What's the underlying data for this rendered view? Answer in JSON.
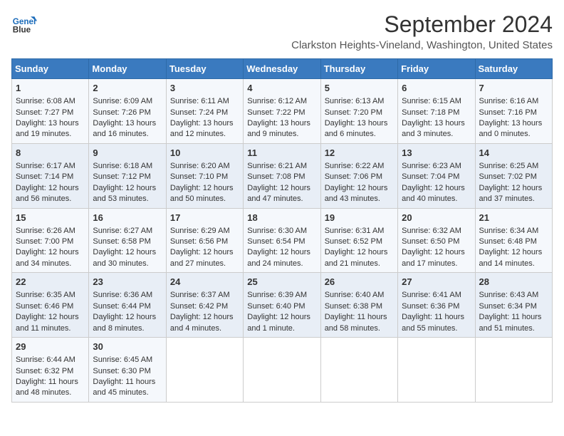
{
  "header": {
    "logo_line1": "General",
    "logo_line2": "Blue",
    "title": "September 2024",
    "subtitle": "Clarkston Heights-Vineland, Washington, United States"
  },
  "days": [
    "Sunday",
    "Monday",
    "Tuesday",
    "Wednesday",
    "Thursday",
    "Friday",
    "Saturday"
  ],
  "weeks": [
    [
      {
        "day": 1,
        "sunrise": "6:08 AM",
        "sunset": "7:27 PM",
        "daylight": "13 hours and 19 minutes."
      },
      {
        "day": 2,
        "sunrise": "6:09 AM",
        "sunset": "7:26 PM",
        "daylight": "13 hours and 16 minutes."
      },
      {
        "day": 3,
        "sunrise": "6:11 AM",
        "sunset": "7:24 PM",
        "daylight": "13 hours and 12 minutes."
      },
      {
        "day": 4,
        "sunrise": "6:12 AM",
        "sunset": "7:22 PM",
        "daylight": "13 hours and 9 minutes."
      },
      {
        "day": 5,
        "sunrise": "6:13 AM",
        "sunset": "7:20 PM",
        "daylight": "13 hours and 6 minutes."
      },
      {
        "day": 6,
        "sunrise": "6:15 AM",
        "sunset": "7:18 PM",
        "daylight": "13 hours and 3 minutes."
      },
      {
        "day": 7,
        "sunrise": "6:16 AM",
        "sunset": "7:16 PM",
        "daylight": "13 hours and 0 minutes."
      }
    ],
    [
      {
        "day": 8,
        "sunrise": "6:17 AM",
        "sunset": "7:14 PM",
        "daylight": "12 hours and 56 minutes."
      },
      {
        "day": 9,
        "sunrise": "6:18 AM",
        "sunset": "7:12 PM",
        "daylight": "12 hours and 53 minutes."
      },
      {
        "day": 10,
        "sunrise": "6:20 AM",
        "sunset": "7:10 PM",
        "daylight": "12 hours and 50 minutes."
      },
      {
        "day": 11,
        "sunrise": "6:21 AM",
        "sunset": "7:08 PM",
        "daylight": "12 hours and 47 minutes."
      },
      {
        "day": 12,
        "sunrise": "6:22 AM",
        "sunset": "7:06 PM",
        "daylight": "12 hours and 43 minutes."
      },
      {
        "day": 13,
        "sunrise": "6:23 AM",
        "sunset": "7:04 PM",
        "daylight": "12 hours and 40 minutes."
      },
      {
        "day": 14,
        "sunrise": "6:25 AM",
        "sunset": "7:02 PM",
        "daylight": "12 hours and 37 minutes."
      }
    ],
    [
      {
        "day": 15,
        "sunrise": "6:26 AM",
        "sunset": "7:00 PM",
        "daylight": "12 hours and 34 minutes."
      },
      {
        "day": 16,
        "sunrise": "6:27 AM",
        "sunset": "6:58 PM",
        "daylight": "12 hours and 30 minutes."
      },
      {
        "day": 17,
        "sunrise": "6:29 AM",
        "sunset": "6:56 PM",
        "daylight": "12 hours and 27 minutes."
      },
      {
        "day": 18,
        "sunrise": "6:30 AM",
        "sunset": "6:54 PM",
        "daylight": "12 hours and 24 minutes."
      },
      {
        "day": 19,
        "sunrise": "6:31 AM",
        "sunset": "6:52 PM",
        "daylight": "12 hours and 21 minutes."
      },
      {
        "day": 20,
        "sunrise": "6:32 AM",
        "sunset": "6:50 PM",
        "daylight": "12 hours and 17 minutes."
      },
      {
        "day": 21,
        "sunrise": "6:34 AM",
        "sunset": "6:48 PM",
        "daylight": "12 hours and 14 minutes."
      }
    ],
    [
      {
        "day": 22,
        "sunrise": "6:35 AM",
        "sunset": "6:46 PM",
        "daylight": "12 hours and 11 minutes."
      },
      {
        "day": 23,
        "sunrise": "6:36 AM",
        "sunset": "6:44 PM",
        "daylight": "12 hours and 8 minutes."
      },
      {
        "day": 24,
        "sunrise": "6:37 AM",
        "sunset": "6:42 PM",
        "daylight": "12 hours and 4 minutes."
      },
      {
        "day": 25,
        "sunrise": "6:39 AM",
        "sunset": "6:40 PM",
        "daylight": "12 hours and 1 minute."
      },
      {
        "day": 26,
        "sunrise": "6:40 AM",
        "sunset": "6:38 PM",
        "daylight": "11 hours and 58 minutes."
      },
      {
        "day": 27,
        "sunrise": "6:41 AM",
        "sunset": "6:36 PM",
        "daylight": "11 hours and 55 minutes."
      },
      {
        "day": 28,
        "sunrise": "6:43 AM",
        "sunset": "6:34 PM",
        "daylight": "11 hours and 51 minutes."
      }
    ],
    [
      {
        "day": 29,
        "sunrise": "6:44 AM",
        "sunset": "6:32 PM",
        "daylight": "11 hours and 48 minutes."
      },
      {
        "day": 30,
        "sunrise": "6:45 AM",
        "sunset": "6:30 PM",
        "daylight": "11 hours and 45 minutes."
      },
      null,
      null,
      null,
      null,
      null
    ]
  ],
  "labels": {
    "sunrise_prefix": "Sunrise: ",
    "sunset_prefix": "Sunset: ",
    "daylight_label": "Daylight: "
  }
}
